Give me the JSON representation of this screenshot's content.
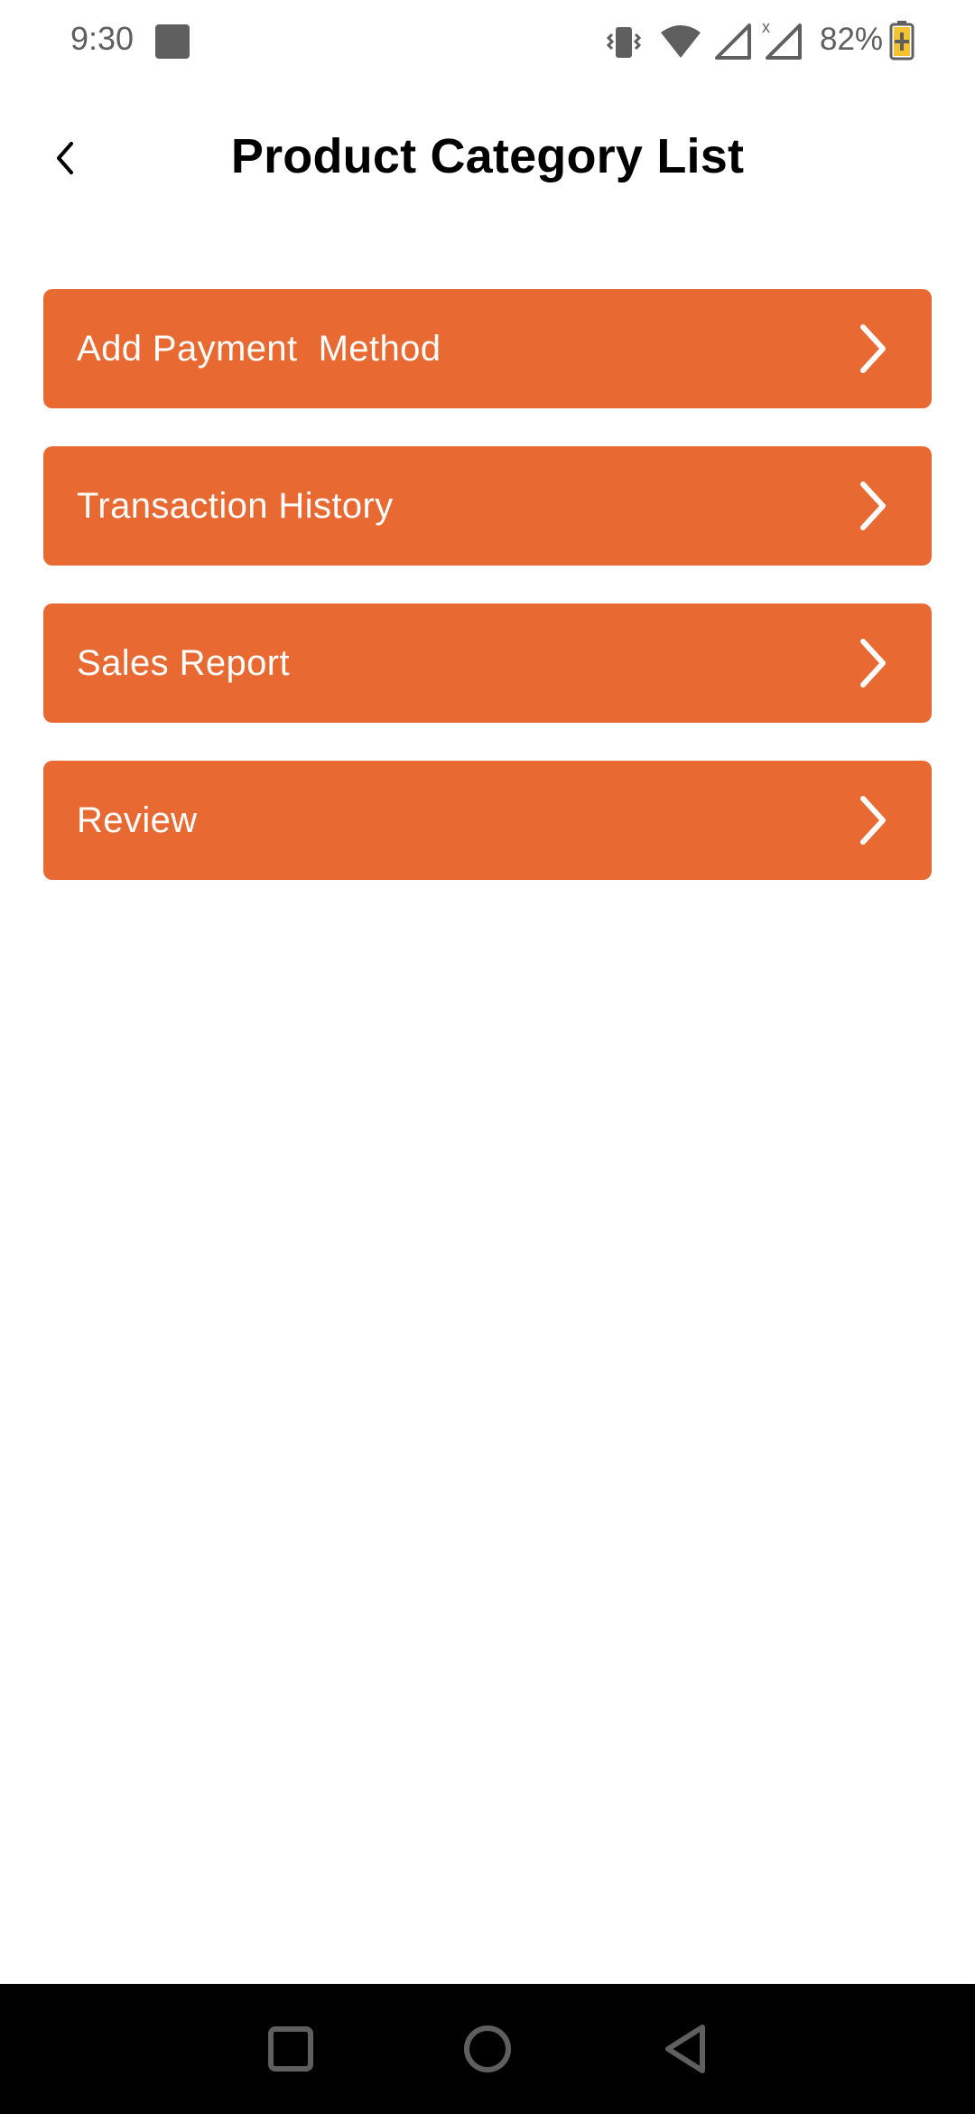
{
  "status_bar": {
    "time": "9:30",
    "battery": "82%",
    "icons": [
      "notification-icon",
      "vibrate-icon",
      "wifi-icon",
      "signal-icon",
      "signal-no-data-icon",
      "battery-charging-icon"
    ]
  },
  "header": {
    "title": "Product Category List",
    "back_icon": "chevron-left-icon"
  },
  "menu": {
    "items": [
      {
        "label": "Add Payment  Method",
        "icon": "chevron-right-icon"
      },
      {
        "label": "Transaction History",
        "icon": "chevron-right-icon"
      },
      {
        "label": "Sales Report",
        "icon": "chevron-right-icon"
      },
      {
        "label": "Review",
        "icon": "chevron-right-icon"
      }
    ]
  },
  "nav_bar": {
    "buttons": [
      "recents-icon",
      "home-icon",
      "back-triangle-icon"
    ]
  },
  "colors": {
    "accent": "#e86932",
    "background": "#ffffff",
    "title_text": "#000000",
    "menu_text": "#ffffff",
    "status_icons": "#5f5f5f",
    "nav_bar_bg": "#000000"
  }
}
